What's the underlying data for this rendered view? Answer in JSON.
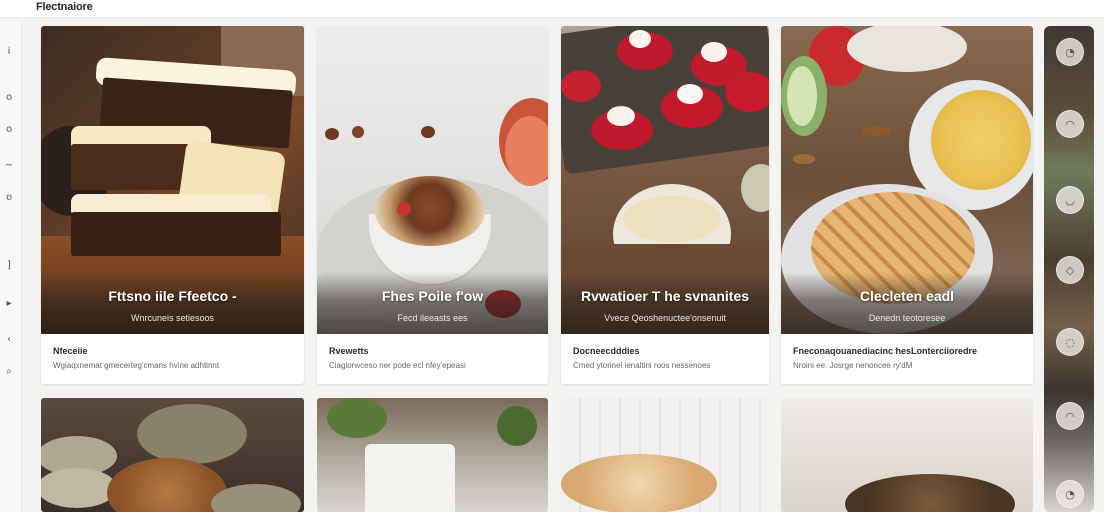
{
  "app": {
    "title": "Flectnaiore"
  },
  "left_rail": {
    "icons": [
      "i",
      "o",
      "o",
      "~",
      "o",
      "]",
      "▸",
      "‹",
      "⌕"
    ]
  },
  "right_rail": {
    "buttons": [
      "◔",
      "◠",
      "◡",
      "◇",
      "◌",
      "◠",
      "◔"
    ]
  },
  "cards": [
    {
      "overlay_title": "Fttsno iile Ffeetco -",
      "overlay_sub": "Wnrcuneis setiesoos",
      "heading": "Nfeceiie",
      "text": "Wgiaqxnemat gmecerteg'cmans hvine adhtinnt"
    },
    {
      "overlay_title": "Fhes Poile f'ow",
      "overlay_sub": "Fecd ileeasts ees",
      "heading": "Rvewetts",
      "text": "Ciaglorwceso ner pode ecl nfey'epeasi"
    },
    {
      "overlay_title": "Rvwatioer T he svnanites",
      "overlay_sub": "Vvece Qeoshenuctee'onsenuit",
      "heading": "Docneecdddies",
      "text": "Cmed ytorinei ienaltini roos nessenoes"
    },
    {
      "overlay_title": "Clecleten eadl",
      "overlay_sub": "Denedn teotoresee",
      "heading": "Fneconaqouanediacinc hesLonterciioredre",
      "text": "Nroini ee: Josrge nenoncee ry'dM"
    }
  ]
}
